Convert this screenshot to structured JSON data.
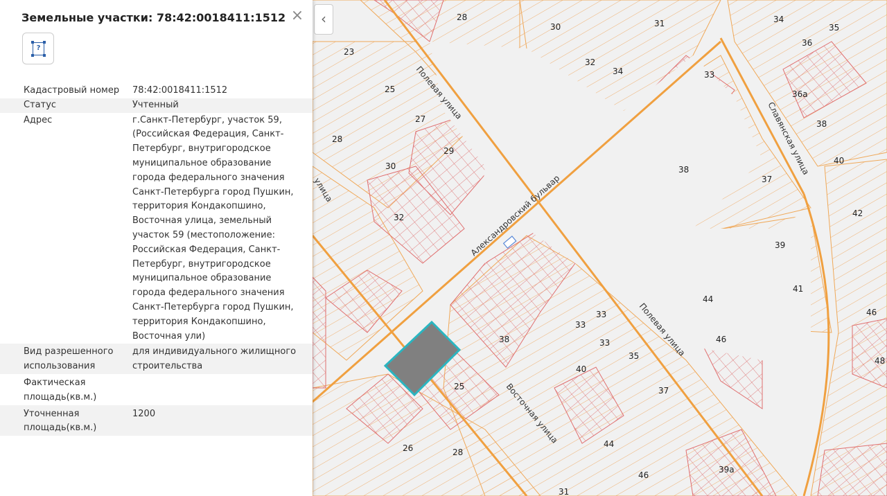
{
  "panel": {
    "title": "Земельные участки: 78:42:0018411:1512",
    "close_icon": "close-icon",
    "button_icon": "unknown-parcel-icon",
    "button_glyph": "?",
    "rows": [
      {
        "label": "Кадастровый номер",
        "value": "78:42:0018411:1512"
      },
      {
        "label": "Статус",
        "value": "Учтенный"
      },
      {
        "label": "Адрес",
        "value": "г.Санкт-Петербург, участок 59, (Российская Федерация, Санкт-Петербург, внутригородское муниципальное образование города федерального значения Санкт-Петербурга город Пушкин, территория Кондакопшино, Восточная улица, земельный участок 59 (местоположение: Российская Федерация, Санкт-Петербург, внутригородское муниципальное образование города федерального значения Санкт-Петербурга город Пушкин, территория Кондакопшино, Восточная ули)"
      },
      {
        "label": "Вид разрешенного использования",
        "value": "для индивидуального жилищного строительства"
      },
      {
        "label": "Фактическая площадь(кв.м.)",
        "value": ""
      },
      {
        "label": "Уточненная площадь(кв.м.)",
        "value": "1200"
      }
    ]
  },
  "collapse": {
    "glyph": "‹",
    "icon": "chevron-left-icon"
  },
  "map": {
    "streets": [
      "Полевая улица",
      "Александровский бульвар",
      "Славянская улица",
      "Полевая улица",
      "Восточная улица",
      "улица"
    ],
    "house_numbers": [
      "28",
      "30",
      "31",
      "34",
      "35",
      "36",
      "23",
      "25",
      "32",
      "34",
      "33",
      "36а",
      "27",
      "28",
      "29",
      "38",
      "38",
      "30",
      "37",
      "40",
      "42",
      "32",
      "39",
      "41",
      "44",
      "46",
      "33",
      "33",
      "38",
      "33",
      "35",
      "40",
      "46",
      "48",
      "25",
      "37",
      "26",
      "28",
      "44",
      "39а",
      "46",
      "31"
    ],
    "colors": {
      "boundary": "#f0a858",
      "parcel_red": "#e07070",
      "road": "#f0a040",
      "selected": "#808080",
      "selected_border": "#2ab5c0"
    }
  }
}
